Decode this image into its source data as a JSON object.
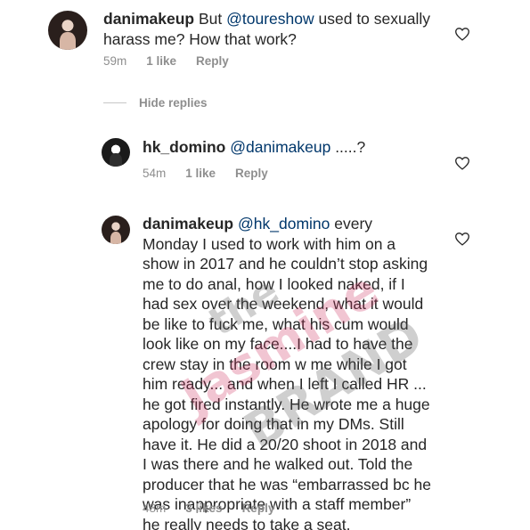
{
  "comments": [
    {
      "username": "danimakeup",
      "pre": " But ",
      "mention": "@toureshow",
      "post": " used to sexually harass me? How that work?",
      "time": "59m",
      "likes": "1 like",
      "reply": "Reply"
    },
    {
      "username": "hk_domino",
      "pre": " ",
      "mention": "@danimakeup",
      "post": " .....?",
      "time": "54m",
      "likes": "1 like",
      "reply": "Reply"
    },
    {
      "username": "danimakeup",
      "pre": " ",
      "mention": "@hk_domino",
      "post": " every Monday I used to work with him on a show in 2017 and he couldn’t stop asking me to do anal, how I looked naked, if I had sex over the weekend, what it would be like to fuck me, what his cum would look like on my face....I had to have the crew stay in the room w me while I got him ready... and when I left I called HR ... he got fired instantly. He wrote me a huge apology for doing that in my DMs. Still have it. He did a 20/20 shoot in 2018 and I was there and he walked out. Told the producer that he was “embarrassed bc he was inappropriate with a staff member” he really needs to take a seat.",
      "time": "48m",
      "likes": "3 likes",
      "reply": "Reply"
    }
  ],
  "thread": {
    "hide_replies": "Hide replies"
  },
  "watermark": {
    "line1": "the",
    "line2": "Jasmine",
    "line3": "BRAND"
  },
  "icons": {
    "like": "heart-outline-icon"
  }
}
